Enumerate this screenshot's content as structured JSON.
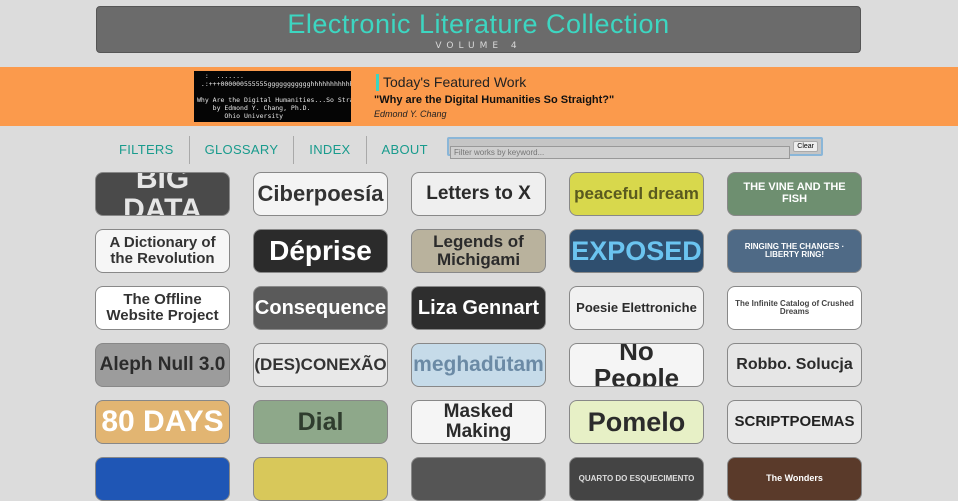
{
  "header": {
    "title": "Electronic Literature Collection",
    "volume": "VOLUME 4"
  },
  "featured": {
    "label": "Today's Featured Work",
    "title": "\"Why are the Digital Humanities So Straight?\"",
    "author": "Edmond Y. Chang",
    "thumb_text": "  :  .......                        \n .:+++000000555555ggggggggggghhhhhhhhhhhhhh+..\n\nWhy Are the Digital Humanities...So Straight?\n    by Edmond Y. Chang, Ph.D.\n       Ohio University"
  },
  "nav": {
    "filters": "FILTERS",
    "glossary": "GLOSSARY",
    "index": "INDEX",
    "about": "ABOUT"
  },
  "filter": {
    "placeholder": "Filter works by keyword...",
    "clear": "Clear"
  },
  "works": [
    {
      "title": "BIG DATA",
      "bg": "#4a4a4a",
      "color": "#e6e6e6",
      "size": 30
    },
    {
      "title": "Ciberpoesía",
      "bg": "#f4f4f4",
      "color": "#333333",
      "size": 22
    },
    {
      "title": "Letters to X",
      "bg": "#efefef",
      "color": "#2b2b2b",
      "size": 19
    },
    {
      "title": "peaceful dream",
      "bg": "#d8d84c",
      "color": "#5a5a1f",
      "size": 17
    },
    {
      "title": "THE VINE AND THE FISH",
      "bg": "#6e8f70",
      "color": "#ffffff",
      "size": 11
    },
    {
      "title": "A Dictionary of the Revolution",
      "bg": "#f6f6f6",
      "color": "#333333",
      "size": 15
    },
    {
      "title": "Déprise",
      "bg": "#2b2b2b",
      "color": "#ffffff",
      "size": 28
    },
    {
      "title": "Legends of Michigami",
      "bg": "#b9b29d",
      "color": "#2b2b2b",
      "size": 17
    },
    {
      "title": "EXPOSED",
      "bg": "#2f4f6f",
      "color": "#6bc4f0",
      "size": 27
    },
    {
      "title": "RINGING THE CHANGES · LIBERTY RING!",
      "bg": "#4f6a86",
      "color": "#ffffff",
      "size": 8
    },
    {
      "title": "The Offline Website Project",
      "bg": "#ffffff",
      "color": "#333333",
      "size": 15
    },
    {
      "title": "Consequence",
      "bg": "#5a5a5a",
      "color": "#ffffff",
      "size": 20
    },
    {
      "title": "Liza Gennart",
      "bg": "#2e2e2e",
      "color": "#ffffff",
      "size": 20
    },
    {
      "title": "Poesie Elettroniche",
      "bg": "#f1f1f1",
      "color": "#2b2b2b",
      "size": 13
    },
    {
      "title": "The Infinite Catalog of Crushed Dreams",
      "bg": "#ffffff",
      "color": "#444444",
      "size": 8
    },
    {
      "title": "Aleph Null 3.0",
      "bg": "#9c9c9c",
      "color": "#2b2b2b",
      "size": 19
    },
    {
      "title": "(DES)CONEXÃO",
      "bg": "#e8e8e8",
      "color": "#333333",
      "size": 17
    },
    {
      "title": "meghadūtam",
      "bg": "#c6dbe9",
      "color": "#6b8aa5",
      "size": 21
    },
    {
      "title": "No People",
      "bg": "#f5f5f5",
      "color": "#2b2b2b",
      "size": 26
    },
    {
      "title": "Robbo. Solucja",
      "bg": "#e6e6e6",
      "color": "#2b2b2b",
      "size": 16
    },
    {
      "title": "80 DAYS",
      "bg": "#e2b572",
      "color": "#ffffff",
      "size": 30
    },
    {
      "title": "Dial",
      "bg": "#8ea88a",
      "color": "#2f3d2e",
      "size": 25
    },
    {
      "title": "Masked Making",
      "bg": "#f5f5f5",
      "color": "#2b2b2b",
      "size": 19
    },
    {
      "title": "Pomelo",
      "bg": "#e7f0c6",
      "color": "#2b2b2b",
      "size": 27
    },
    {
      "title": "SCRIPTPOEMAS",
      "bg": "#e9e9e9",
      "color": "#222222",
      "size": 15
    }
  ],
  "partial_row": [
    {
      "title": "",
      "bg": "#1f56b5"
    },
    {
      "title": "",
      "bg": "#d8c85a"
    },
    {
      "title": "",
      "bg": "#555555"
    },
    {
      "title": "QUARTO DO ESQUECIMENTO",
      "bg": "#444444",
      "color": "#dddddd",
      "size": 8
    },
    {
      "title": "The Wonders",
      "bg": "#5a3a2a",
      "color": "#ffffff",
      "size": 9
    }
  ]
}
